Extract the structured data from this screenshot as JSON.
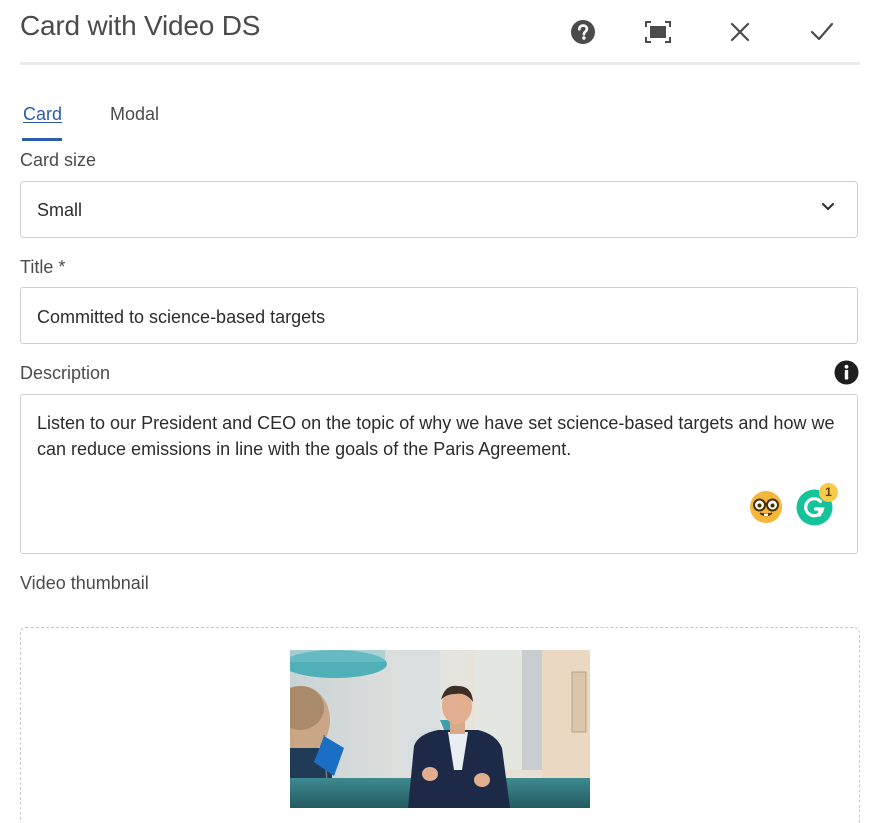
{
  "dialog": {
    "title": "Card with Video DS"
  },
  "tabs": [
    {
      "label": "Card",
      "active": true
    },
    {
      "label": "Modal",
      "active": false
    }
  ],
  "fields": {
    "card_size": {
      "label": "Card size",
      "value": "Small"
    },
    "title": {
      "label": "Title *",
      "value": "Committed to science-based targets"
    },
    "description": {
      "label": "Description",
      "value": "Listen to our President and CEO on the topic of why we have set science-based targets and how we can reduce emissions in line with the goals of the Paris Agreement.",
      "grammarly_count": "1"
    },
    "video_thumbnail": {
      "label": "Video thumbnail"
    }
  },
  "icons": {
    "help": "help-icon",
    "fullscreen": "fullscreen-icon",
    "close": "close-icon",
    "done": "checkmark-icon",
    "chevron": "chevron-down-icon",
    "info": "info-icon",
    "emoji": "nerd-face-emoji-icon",
    "grammarly": "grammarly-icon"
  },
  "colors": {
    "accent": "#2c5cab",
    "grammarly": "#15c39a",
    "badge": "#f8c94b"
  }
}
